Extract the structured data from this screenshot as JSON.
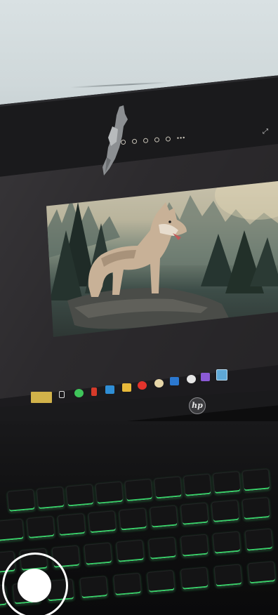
{
  "screen_brand": "hp",
  "photo_subject": "wolf",
  "colors": {
    "keyboard_backlight": "#39d26a",
    "shutter": "#ffffff",
    "wall": "#d6dfe1"
  },
  "viewer_toolbar": {
    "icons": [
      "share-icon",
      "favorite-icon",
      "rotate-icon",
      "info-icon",
      "delete-icon",
      "more-icon"
    ],
    "more_glyph": "•••"
  },
  "taskbar": {
    "icons": [
      "whatsapp-icon",
      "office-icon",
      "mail-icon",
      "file-explorer-icon",
      "opera-icon",
      "paint-icon",
      "store-icon",
      "photos-icon",
      "visual-studio-icon",
      "active-app-icon"
    ]
  },
  "keyboard": {
    "row1": [
      "",
      "",
      "",
      "",
      "",
      "",
      "",
      "",
      "",
      ""
    ],
    "row2": [
      "",
      "",
      "",
      "",
      "",
      "",
      "",
      "",
      ""
    ],
    "row3": [
      "",
      "",
      "",
      "",
      "",
      "",
      "",
      "",
      ""
    ],
    "row4": [
      "",
      "",
      "",
      "",
      "",
      "",
      "",
      "",
      ""
    ]
  },
  "camera": {
    "shutter_label": ""
  }
}
